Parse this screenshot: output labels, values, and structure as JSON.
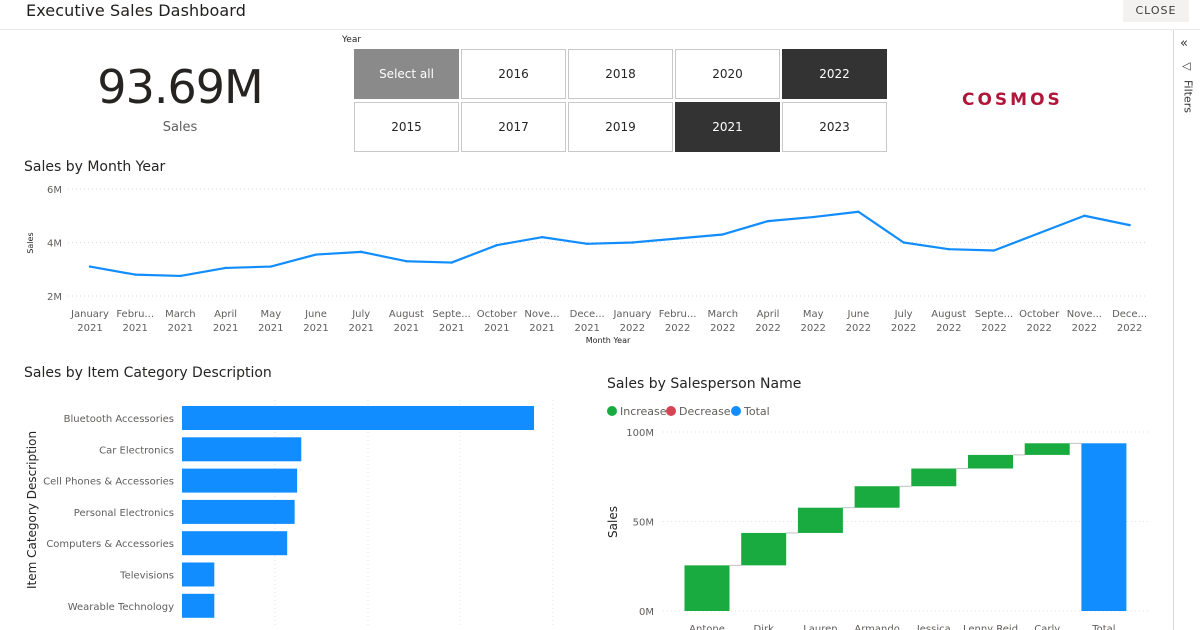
{
  "header": {
    "title": "Executive Sales Dashboard",
    "close_label": "CLOSE"
  },
  "filter_pane": {
    "label": "Filters",
    "collapse_icon": "double-chevron-left-icon",
    "filter_icon": "funnel-icon"
  },
  "kpi": {
    "value": "93.69M",
    "label": "Sales"
  },
  "year_slicer": {
    "label": "Year",
    "options": [
      {
        "label": "Select all",
        "state": "select-all"
      },
      {
        "label": "2016",
        "state": "off"
      },
      {
        "label": "2018",
        "state": "off"
      },
      {
        "label": "2020",
        "state": "off"
      },
      {
        "label": "2022",
        "state": "selected"
      },
      {
        "label": "2015",
        "state": "off"
      },
      {
        "label": "2017",
        "state": "off"
      },
      {
        "label": "2019",
        "state": "off"
      },
      {
        "label": "2021",
        "state": "selected"
      },
      {
        "label": "2023",
        "state": "off"
      }
    ]
  },
  "logo": {
    "text": "COSMOS",
    "color": "#b0163a"
  },
  "colors": {
    "accent": "#118dff",
    "increase": "#1aab40",
    "decrease": "#d64554",
    "total": "#118dff",
    "selected": "#333333"
  },
  "chart_data": [
    {
      "type": "line",
      "title": "Sales by Month Year",
      "xlabel": "Month Year",
      "ylabel": "Sales",
      "y_ticks": [
        "2M",
        "4M",
        "6M"
      ],
      "ylim": [
        2,
        6
      ],
      "y_unit": "M",
      "grid": true,
      "x": [
        [
          "January",
          "2021"
        ],
        [
          "Febru...",
          "2021"
        ],
        [
          "March",
          "2021"
        ],
        [
          "April",
          "2021"
        ],
        [
          "May",
          "2021"
        ],
        [
          "June",
          "2021"
        ],
        [
          "July",
          "2021"
        ],
        [
          "August",
          "2021"
        ],
        [
          "Septe...",
          "2021"
        ],
        [
          "October",
          "2021"
        ],
        [
          "Nove...",
          "2021"
        ],
        [
          "Dece...",
          "2021"
        ],
        [
          "January",
          "2022"
        ],
        [
          "Febru...",
          "2022"
        ],
        [
          "March",
          "2022"
        ],
        [
          "April",
          "2022"
        ],
        [
          "May",
          "2022"
        ],
        [
          "June",
          "2022"
        ],
        [
          "July",
          "2022"
        ],
        [
          "August",
          "2022"
        ],
        [
          "Septe...",
          "2022"
        ],
        [
          "October",
          "2022"
        ],
        [
          "Nove...",
          "2022"
        ],
        [
          "Dece...",
          "2022"
        ]
      ],
      "series": [
        {
          "values": [
            3.1,
            2.8,
            2.75,
            3.05,
            3.1,
            3.55,
            3.65,
            3.3,
            3.25,
            3.9,
            4.2,
            3.95,
            4.0,
            4.15,
            4.3,
            4.8,
            4.95,
            5.15,
            4.0,
            3.75,
            3.7,
            4.35,
            5.0,
            4.65
          ],
          "color": "#118dff"
        }
      ]
    },
    {
      "type": "bar",
      "orientation": "horizontal",
      "title": "Sales by Item Category Description",
      "ylabel": "Item Category Description",
      "categories": [
        "Bluetooth Accessories",
        "Car Electronics",
        "Cell Phones & Accessories",
        "Personal Electronics",
        "Computers & Accessories",
        "Televisions",
        "Wearable Technology"
      ],
      "values": [
        42.5,
        14.4,
        13.9,
        13.6,
        12.7,
        3.9,
        3.9
      ],
      "color": "#118dff"
    },
    {
      "type": "bar",
      "subtype": "waterfall",
      "title": "Sales by Salesperson Name",
      "ylabel": "Sales",
      "y_ticks": [
        "0M",
        "50M",
        "100M"
      ],
      "ylim": [
        0,
        100
      ],
      "legend": [
        {
          "name": "Increase",
          "color": "#1aab40"
        },
        {
          "name": "Decrease",
          "color": "#d64554"
        },
        {
          "name": "Total",
          "color": "#118dff"
        }
      ],
      "legend_position": "top-left",
      "categories": [
        "Antone",
        "Dirk",
        "Lauren",
        "Armando",
        "Jessica",
        "Lenny Reid",
        "Carly",
        "Total"
      ],
      "steps": [
        25.5,
        18.1,
        14.1,
        12.0,
        9.9,
        7.6,
        6.5
      ],
      "total": 93.69
    }
  ]
}
